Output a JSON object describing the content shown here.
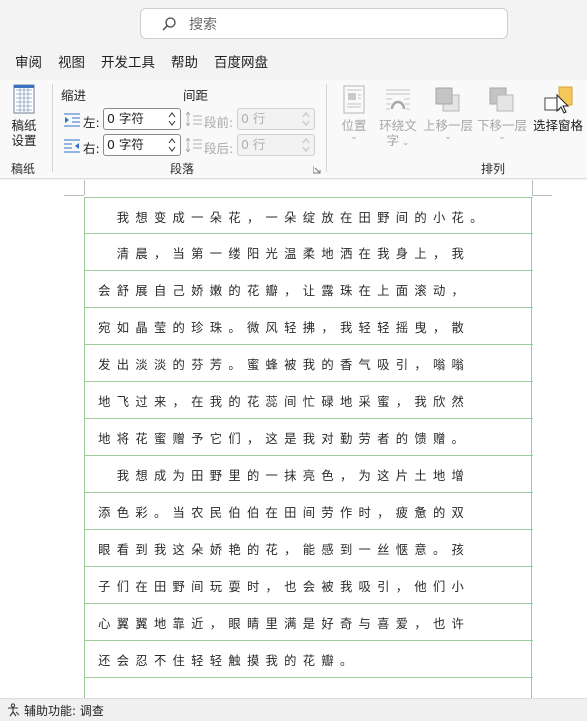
{
  "search": {
    "placeholder": "搜索"
  },
  "menu": [
    "审阅",
    "视图",
    "开发工具",
    "帮助",
    "百度网盘"
  ],
  "ribbon": {
    "manuscript": {
      "button_line1": "稿纸",
      "button_line2": "设置",
      "group": "稿纸"
    },
    "paragraph": {
      "indent_title": "缩进",
      "spacing_title": "间距",
      "left_label": "左:",
      "left_value": "0 字符",
      "right_label": "右:",
      "right_value": "0 字符",
      "before_label": "段前:",
      "before_value": "0 行",
      "after_label": "段后:",
      "after_value": "0 行",
      "group": "段落"
    },
    "arrange": {
      "position": "位置",
      "wrap_line1": "环绕文",
      "wrap_line2": "字",
      "bring_forward": "上移一层",
      "send_backward": "下移一层",
      "selection_pane": "选择窗格",
      "group": "排列"
    }
  },
  "document": {
    "rows": [
      "  我想变成一朵花，一朵绽放在田野间的小花。",
      "  清晨，当第一缕阳光温柔地洒在我身上，我",
      "会舒展自己娇嫩的花瓣，让露珠在上面滚动，",
      "宛如晶莹的珍珠。微风轻拂，我轻轻摇曳，散",
      "发出淡淡的芬芳。蜜蜂被我的香气吸引，嗡嗡",
      "地飞过来，在我的花蕊间忙碌地采蜜，我欣然",
      "地将花蜜赠予它们，这是我对勤劳者的馈赠。",
      "  我想成为田野里的一抹亮色，为这片土地增",
      "添色彩。当农民伯伯在田间劳作时，疲惫的双",
      "眼看到我这朵娇艳的花，能感到一丝惬意。孩",
      "子们在田野间玩耍时，也会被我吸引，他们小",
      "心翼翼地靠近，眼睛里满是好奇与喜爱，也许",
      "还会忍不住轻轻触摸我的花瓣。",
      ""
    ]
  },
  "status": {
    "text": "辅助功能: 调查"
  },
  "colors": {
    "grid_line": "#9ccc9c",
    "page": "#ffffff",
    "chrome": "#f3f3f3"
  }
}
